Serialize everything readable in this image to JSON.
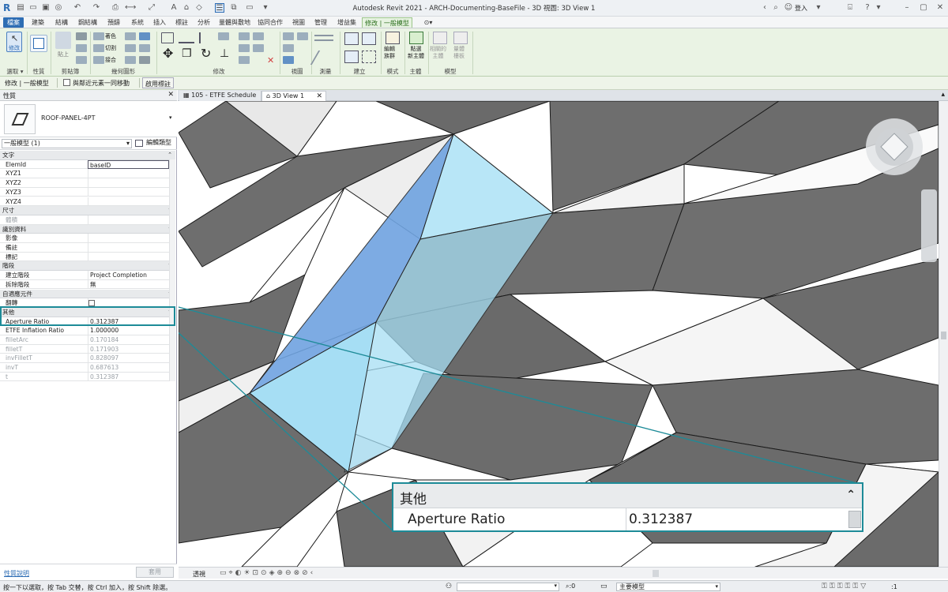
{
  "titlebar": {
    "title": "Autodesk Revit 2021 - ARCH-Documenting-BaseFile - 3D 視圖: 3D View 1",
    "user": "登入"
  },
  "ribbon_tabs": [
    "檔案",
    "建築",
    "結構",
    "鋼結構",
    "預鑄",
    "系統",
    "插入",
    "標註",
    "分析",
    "量體與敷地",
    "協同合作",
    "視圖",
    "管理",
    "增益集",
    "修改 | 一般模型"
  ],
  "ribbon": {
    "modify_label": "修改",
    "paste_label": "貼上",
    "cut_label": "切割",
    "join_label": "接合",
    "copy_label": "著色",
    "groups": [
      "選取",
      "性質",
      "剪貼簿",
      "幾何圖形",
      "修改",
      "視圖",
      "測量",
      "建立",
      "模式",
      "主體",
      "模型"
    ],
    "edit_family": "編輯\n族群",
    "pick_host": "點選\n新主體",
    "adaptive1": "相關的\n主體",
    "adaptive2": "量體\n樓板"
  },
  "optionsbar": {
    "context": "修改 | 一般模型",
    "move_with": "與鄰近元素一同移動",
    "activate": "啟用標註"
  },
  "properties": {
    "header": "性質",
    "family_name": "ROOF-PANEL-4PT",
    "instance_filter": "一般模型 (1)",
    "edit_type": "編輯類型",
    "sections": [
      {
        "title": "文字",
        "rows": [
          {
            "key": "ElemId",
            "value": "baseID"
          },
          {
            "key": "XYZ1",
            "value": ""
          },
          {
            "key": "XYZ2",
            "value": ""
          },
          {
            "key": "XYZ3",
            "value": ""
          },
          {
            "key": "XYZ4",
            "value": ""
          }
        ]
      },
      {
        "title": "尺寸",
        "rows": [
          {
            "key": "體積",
            "value": ""
          }
        ]
      },
      {
        "title": "識別資料",
        "rows": [
          {
            "key": "影像",
            "value": ""
          },
          {
            "key": "備註",
            "value": ""
          },
          {
            "key": "標記",
            "value": ""
          }
        ]
      },
      {
        "title": "階段",
        "rows": [
          {
            "key": "建立階段",
            "value": "Project Completion"
          },
          {
            "key": "拆除階段",
            "value": "無"
          }
        ]
      },
      {
        "title": "自適應元件",
        "rows": [
          {
            "key": "翻轉",
            "value": ""
          }
        ]
      },
      {
        "title": "其他",
        "rows": [
          {
            "key": "Aperture Ratio",
            "value": "0.312387"
          },
          {
            "key": "ETFE Inflation Ratio",
            "value": "1.000000"
          },
          {
            "key": "filletArc",
            "value": "0.170184"
          },
          {
            "key": "filletT",
            "value": "0.171903"
          },
          {
            "key": "invFilletT",
            "value": "0.828097"
          },
          {
            "key": "invT",
            "value": "0.687613"
          },
          {
            "key": "t",
            "value": "0.312387"
          }
        ]
      }
    ],
    "help_link": "性質說明",
    "apply_label": "套用"
  },
  "view_tabs": [
    {
      "label": "105 - ETFE Schedule"
    },
    {
      "label": "3D View 1"
    }
  ],
  "callout": {
    "section": "其他",
    "key": "Aperture Ratio",
    "value": "0.312387",
    "number": "1"
  },
  "viewcontrol": {
    "mode": "透視"
  },
  "statusbar": {
    "hint": "按一下以選取，按 Tab 交替，按 Ctrl 加入，按 Shift 除選。",
    "coord": ":0",
    "model": "主要模型",
    "filter": ":1"
  },
  "colors": {
    "accent_teal": "#1d8b98",
    "selection_blue": "#a6def4",
    "panel_dark": "#6f6f6f",
    "ribbon_green": "#eaf3e4"
  }
}
